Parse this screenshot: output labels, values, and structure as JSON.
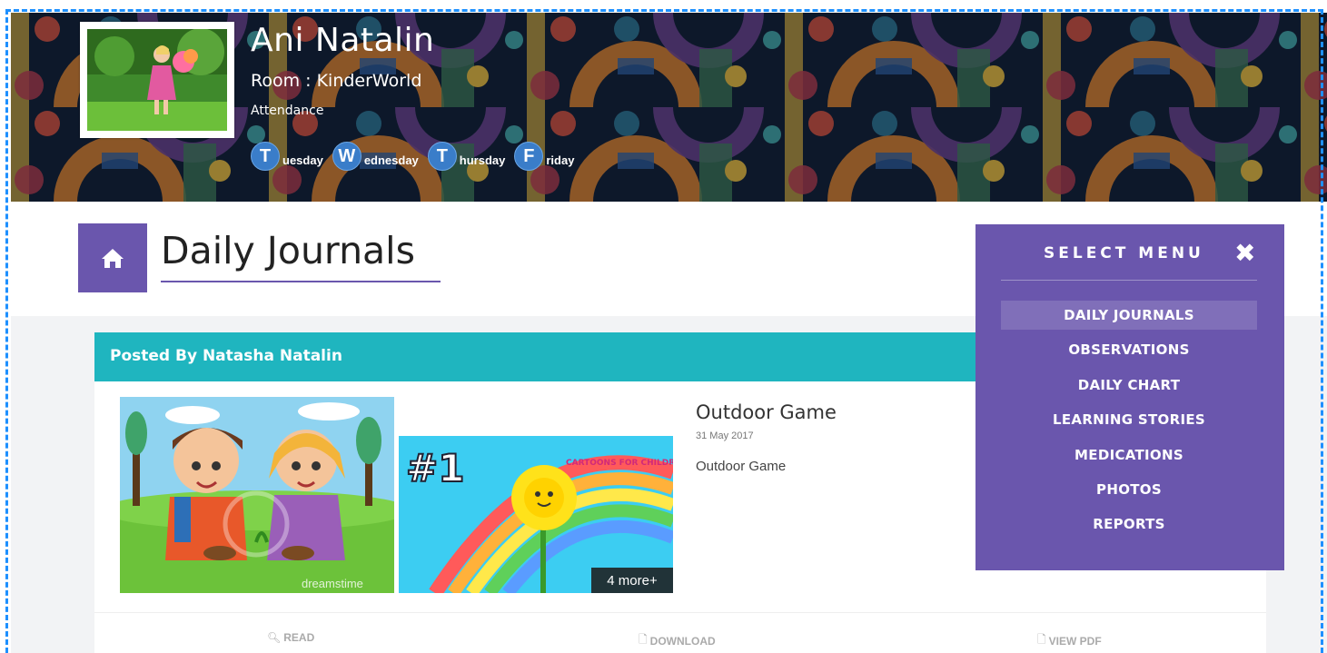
{
  "profile": {
    "name": "Ani Natalin",
    "room": "Room : KinderWorld",
    "attendance_label": "Attendance",
    "days": [
      {
        "initial": "T",
        "rest": "uesday"
      },
      {
        "initial": "W",
        "rest": "ednesday"
      },
      {
        "initial": "T",
        "rest": "hursday"
      },
      {
        "initial": "F",
        "rest": "riday"
      }
    ]
  },
  "page": {
    "title": "Daily Journals",
    "home_icon": "home-icon"
  },
  "journal": {
    "posted_by": "Posted By Natasha Natalin",
    "title": "Outdoor Game",
    "date": "31 May 2017",
    "description": "Outdoor Game",
    "more_photos": "4 more+",
    "actions": {
      "read": "READ",
      "download": "DOWNLOAD",
      "view_pdf": "VIEW PDF"
    },
    "image2_badge": "#1",
    "image2_caption": "CARTOONS FOR CHILDREN",
    "image1_watermark": "dreamstime"
  },
  "menu": {
    "title": "SELECT MENU",
    "items": [
      {
        "label": "DAILY JOURNALS",
        "active": true
      },
      {
        "label": "OBSERVATIONS",
        "active": false
      },
      {
        "label": "DAILY CHART",
        "active": false
      },
      {
        "label": "LEARNING STORIES",
        "active": false
      },
      {
        "label": "MEDICATIONS",
        "active": false
      },
      {
        "label": "PHOTOS",
        "active": false
      },
      {
        "label": "REPORTS",
        "active": false
      }
    ]
  },
  "colors": {
    "accent_purple": "#6a56ad",
    "header_teal": "#1fb5bf",
    "day_blue": "#3a7dc9"
  }
}
